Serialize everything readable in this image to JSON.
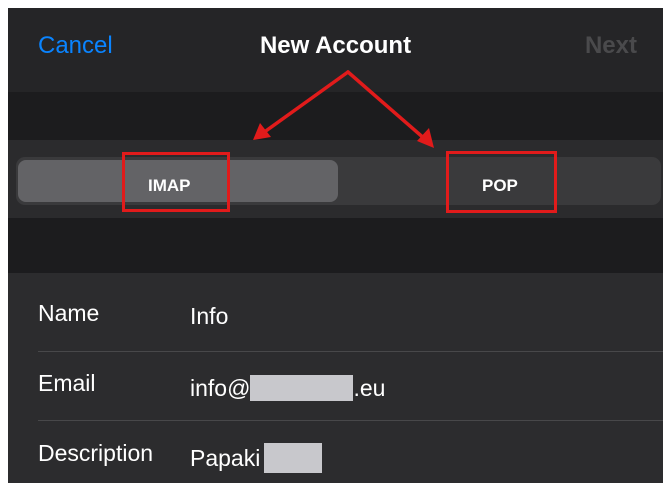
{
  "nav": {
    "cancel": "Cancel",
    "title": "New Account",
    "next": "Next"
  },
  "segment": {
    "options": [
      "IMAP",
      "POP"
    ],
    "selected": "IMAP"
  },
  "form": {
    "rows": [
      {
        "label": "Name",
        "value": "Info"
      },
      {
        "label": "Email",
        "value_prefix": "info@",
        "value_suffix": ".eu"
      },
      {
        "label": "Description",
        "value": "Papaki"
      }
    ]
  },
  "colors": {
    "accent": "#0a84ff",
    "annotation": "#e11b1b",
    "background": "#1c1c1e"
  }
}
